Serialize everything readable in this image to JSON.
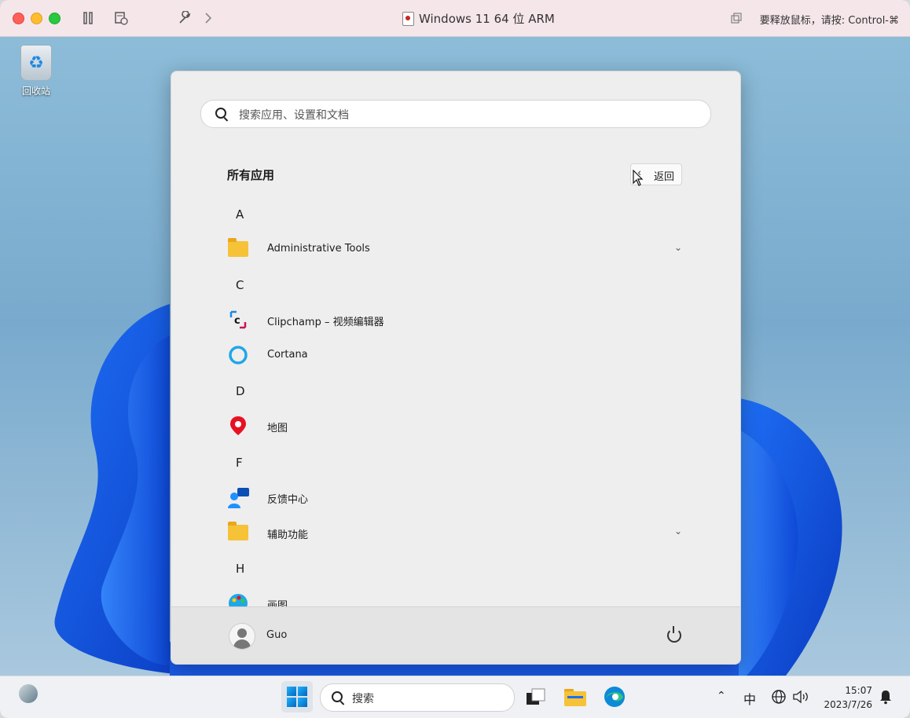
{
  "window": {
    "title": "Windows 11 64 位 ARM",
    "release_hint": "要释放鼠标，请按: Control-⌘",
    "toolbar_icons": [
      "pause-icon",
      "snapshot-icon",
      "wrench-icon",
      "chevron-right-icon",
      "window-icon"
    ]
  },
  "desktop": {
    "recycle_bin_label": "回收站"
  },
  "start_menu": {
    "search_placeholder": "搜索应用、设置和文档",
    "section_title": "所有应用",
    "back_label": "返回",
    "groups": [
      {
        "letter": "A",
        "apps": [
          {
            "name": "Administrative Tools",
            "icon": "folder-icon",
            "expandable": true
          }
        ]
      },
      {
        "letter": "C",
        "apps": [
          {
            "name": "Clipchamp – 视频编辑器",
            "icon": "clipchamp-icon",
            "expandable": false
          },
          {
            "name": "Cortana",
            "icon": "cortana-icon",
            "expandable": false
          }
        ]
      },
      {
        "letter": "D",
        "apps": [
          {
            "name": "地图",
            "icon": "maps-icon",
            "expandable": false
          }
        ]
      },
      {
        "letter": "F",
        "apps": [
          {
            "name": "反馈中心",
            "icon": "feedback-hub-icon",
            "expandable": false
          },
          {
            "name": "辅助功能",
            "icon": "folder-icon",
            "expandable": true
          }
        ]
      },
      {
        "letter": "H",
        "apps": [
          {
            "name": "画图",
            "icon": "paint-icon",
            "expandable": false
          }
        ]
      }
    ],
    "user_name": "Guo"
  },
  "taskbar": {
    "search_label": "搜索",
    "ime_label": "中",
    "time": "15:07",
    "date": "2023/7/26"
  },
  "colors": {
    "accent": "#0067c0",
    "folder": "#f6c237",
    "maps_red": "#e81123",
    "cortana": "#1fa7e8"
  }
}
